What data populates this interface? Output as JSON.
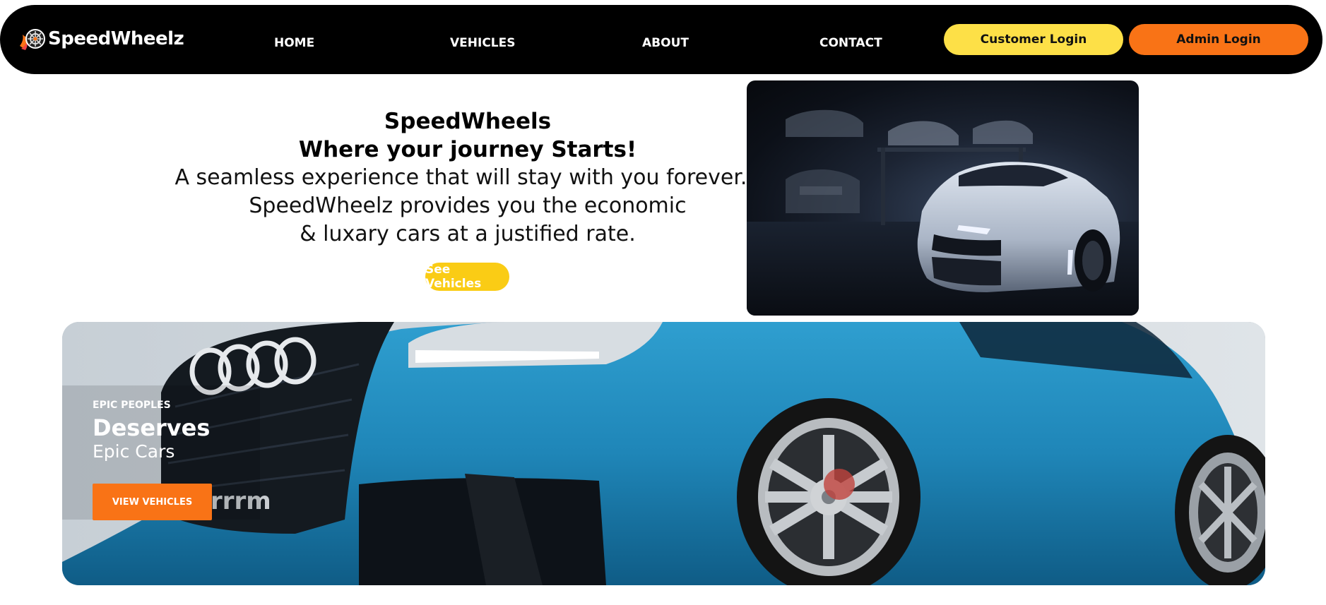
{
  "nav": {
    "brand": "SpeedWheelz",
    "links": [
      "HOME",
      "VEHICLES",
      "ABOUT",
      "CONTACT"
    ],
    "customer_login": "Customer Login",
    "admin_login": "Admin Login"
  },
  "hero": {
    "title_line1": "SpeedWheels",
    "title_line2": "Where your journey Starts!",
    "line1": "A seamless experience that will stay with you forever...",
    "line2": "SpeedWheelz provides you the economic",
    "line3": "& luxary cars at a justified rate.",
    "cta": "See Vehicles"
  },
  "banner": {
    "kicker": "EPIC PEOPLES",
    "title": "Deserves",
    "subtitle": "Epic Cars",
    "cta": "VIEW VEHICLES",
    "grille_badge": "rrrm"
  },
  "colors": {
    "nav_bg": "#000000",
    "customer_btn": "#fde047",
    "admin_btn": "#f97316",
    "see_btn": "#facc15",
    "view_btn": "#f97316",
    "car_blue": "#1f86b8"
  }
}
